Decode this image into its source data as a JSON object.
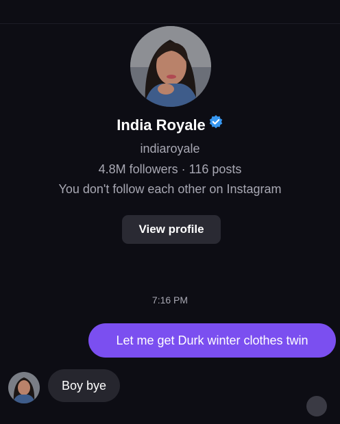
{
  "profile": {
    "display_name": "India Royale",
    "username": "indiaroyale",
    "stats": "4.8M followers · 116 posts",
    "follow_status": "You don't follow each other on Instagram",
    "view_profile_label": "View profile",
    "verified_icon": "verified-badge-icon",
    "verified_color": "#3797f0"
  },
  "thread": {
    "timestamp": "7:16 PM",
    "messages": [
      {
        "direction": "sent",
        "text": "Let me get Durk winter clothes twin"
      },
      {
        "direction": "received",
        "text": "Boy bye"
      }
    ]
  },
  "colors": {
    "background": "#0d0d14",
    "sent_bubble": "#7b4ff0",
    "received_bubble": "#26262e",
    "button": "#2a2a33",
    "secondary_text": "#a8a8b3"
  }
}
